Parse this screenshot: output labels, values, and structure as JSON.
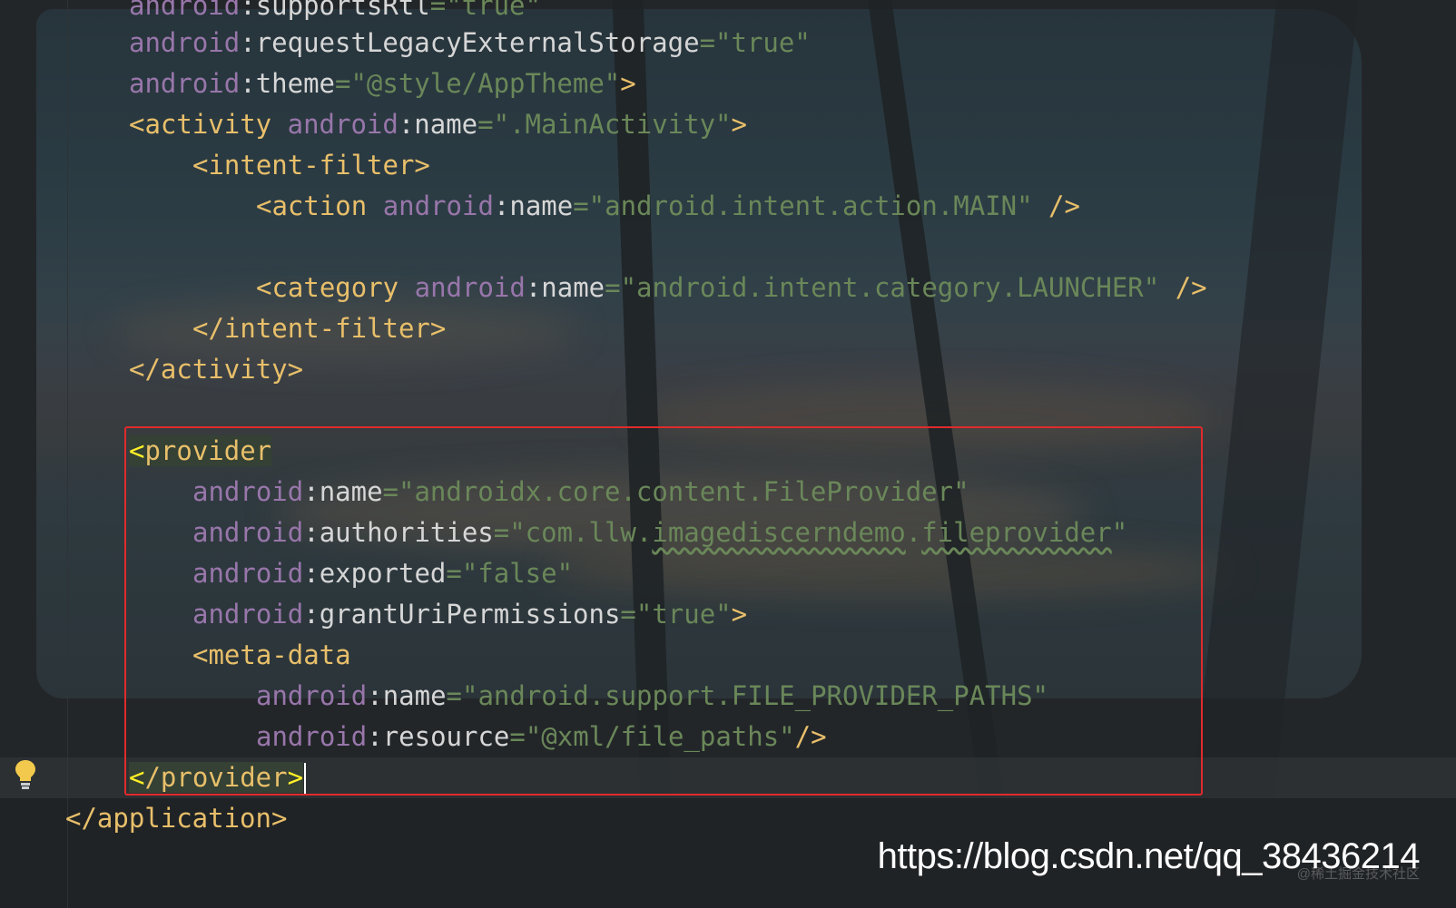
{
  "editor": {
    "lines": [
      {
        "parts": [
          [
            "ns",
            "android"
          ],
          [
            "punc",
            ":"
          ],
          [
            "attr",
            "supportsRtl"
          ],
          [
            "str",
            "=\"true\""
          ]
        ]
      },
      {
        "parts": [
          [
            "ns",
            "android"
          ],
          [
            "punc",
            ":"
          ],
          [
            "attr",
            "requestLegacyExternalStorage"
          ],
          [
            "str",
            "=\"true\""
          ]
        ]
      },
      {
        "parts": [
          [
            "ns",
            "android"
          ],
          [
            "punc",
            ":"
          ],
          [
            "attr",
            "theme"
          ],
          [
            "str",
            "=\"@style/AppTheme\""
          ],
          [
            "tag",
            ">"
          ]
        ]
      },
      {
        "parts": [
          [
            "tag",
            "<activity "
          ],
          [
            "ns",
            "android"
          ],
          [
            "punc",
            ":"
          ],
          [
            "attr",
            "name"
          ],
          [
            "str",
            "=\".MainActivity\""
          ],
          [
            "tag",
            ">"
          ]
        ]
      },
      {
        "parts": [
          [
            "tag",
            "<intent-filter>"
          ]
        ]
      },
      {
        "parts": [
          [
            "tag",
            "<action "
          ],
          [
            "ns",
            "android"
          ],
          [
            "punc",
            ":"
          ],
          [
            "attr",
            "name"
          ],
          [
            "str",
            "=\"android.intent.action.MAIN\" "
          ],
          [
            "tag",
            "/>"
          ]
        ]
      },
      {
        "parts": []
      },
      {
        "parts": [
          [
            "tag",
            "<category "
          ],
          [
            "ns",
            "android"
          ],
          [
            "punc",
            ":"
          ],
          [
            "attr",
            "name"
          ],
          [
            "str",
            "=\"android.intent.category.LAUNCHER\" "
          ],
          [
            "tag",
            "/>"
          ]
        ]
      },
      {
        "parts": [
          [
            "tag",
            "</intent-filter>"
          ]
        ]
      },
      {
        "parts": [
          [
            "tag",
            "</activity>"
          ]
        ]
      },
      {
        "parts": []
      },
      {
        "parts": [
          [
            "hl-open",
            "<provider"
          ]
        ]
      },
      {
        "parts": [
          [
            "ns",
            "android"
          ],
          [
            "punc",
            ":"
          ],
          [
            "attr",
            "name"
          ],
          [
            "str",
            "=\"androidx.core.content.FileProvider\""
          ]
        ]
      },
      {
        "parts": [
          [
            "ns",
            "android"
          ],
          [
            "punc",
            ":"
          ],
          [
            "attr",
            "authorities"
          ],
          [
            "str",
            "=\"com.llw."
          ],
          [
            "sq",
            "imagediscerndemo"
          ],
          [
            "str",
            "."
          ],
          [
            "sq",
            "fileprovider"
          ],
          [
            "str",
            "\""
          ]
        ]
      },
      {
        "parts": [
          [
            "ns",
            "android"
          ],
          [
            "punc",
            ":"
          ],
          [
            "attr",
            "exported"
          ],
          [
            "str",
            "=\"false\""
          ]
        ]
      },
      {
        "parts": [
          [
            "ns",
            "android"
          ],
          [
            "punc",
            ":"
          ],
          [
            "attr",
            "grantUriPermissions"
          ],
          [
            "str",
            "=\"true\""
          ],
          [
            "tag",
            ">"
          ]
        ]
      },
      {
        "parts": [
          [
            "tag",
            "<meta-data"
          ]
        ]
      },
      {
        "parts": [
          [
            "ns",
            "android"
          ],
          [
            "punc",
            ":"
          ],
          [
            "attr",
            "name"
          ],
          [
            "str",
            "=\"android.support.FILE_PROVIDER_PATHS\""
          ]
        ]
      },
      {
        "parts": [
          [
            "ns",
            "android"
          ],
          [
            "punc",
            ":"
          ],
          [
            "attr",
            "resource"
          ],
          [
            "str",
            "=\"@xml/file_paths\""
          ],
          [
            "tag",
            "/>"
          ]
        ]
      },
      {
        "parts": [
          [
            "hl-close",
            "</provider"
          ],
          [
            "hl-bracket",
            ">"
          ]
        ]
      },
      {
        "parts": [
          [
            "tag",
            "</application>"
          ]
        ]
      }
    ]
  },
  "icons": {
    "gutter": "lightbulb-icon"
  },
  "colors": {
    "tag": "#e8bf6a",
    "namespace": "#9876aa",
    "string": "#6a8759",
    "highlight_box": "#e02b2b"
  },
  "watermark": {
    "url": "https://blog.csdn.net/qq_38436214",
    "sub": "@稀土掘金技术社区"
  }
}
